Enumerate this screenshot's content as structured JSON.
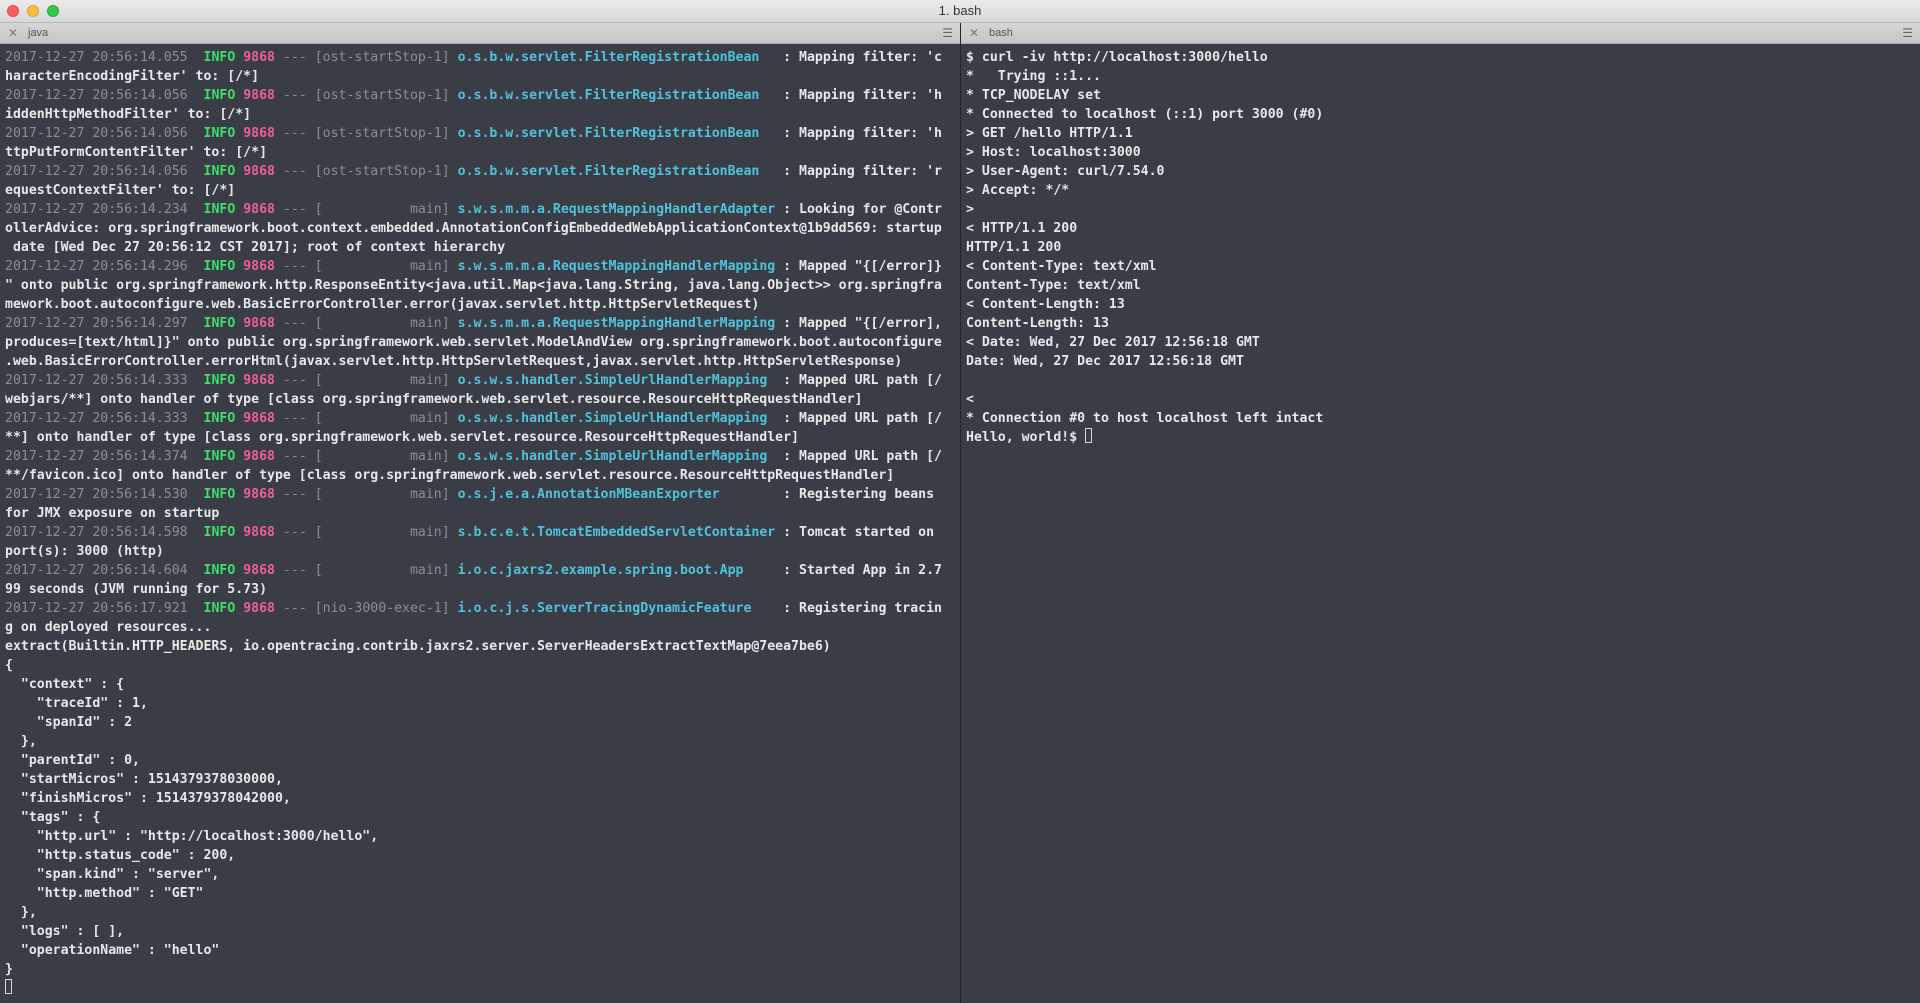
{
  "window": {
    "title": "1. bash"
  },
  "left_pane": {
    "tab_label": "java",
    "log_lines": [
      {
        "ts": "2017-12-27 20:56:14.055",
        "level": "INFO",
        "pid": "9868",
        "sep": " --- ",
        "thread": "[ost-startStop-1]",
        "logger": "o.s.b.w.servlet.FilterRegistrationBean  ",
        "msg": " : Mapping filter: 'c",
        "cont": [
          "haracterEncodingFilter' to: [/*]"
        ]
      },
      {
        "ts": "2017-12-27 20:56:14.056",
        "level": "INFO",
        "pid": "9868",
        "sep": " --- ",
        "thread": "[ost-startStop-1]",
        "logger": "o.s.b.w.servlet.FilterRegistrationBean  ",
        "msg": " : Mapping filter: 'h",
        "cont": [
          "iddenHttpMethodFilter' to: [/*]"
        ]
      },
      {
        "ts": "2017-12-27 20:56:14.056",
        "level": "INFO",
        "pid": "9868",
        "sep": " --- ",
        "thread": "[ost-startStop-1]",
        "logger": "o.s.b.w.servlet.FilterRegistrationBean  ",
        "msg": " : Mapping filter: 'h",
        "cont": [
          "ttpPutFormContentFilter' to: [/*]"
        ]
      },
      {
        "ts": "2017-12-27 20:56:14.056",
        "level": "INFO",
        "pid": "9868",
        "sep": " --- ",
        "thread": "[ost-startStop-1]",
        "logger": "o.s.b.w.servlet.FilterRegistrationBean  ",
        "msg": " : Mapping filter: 'r",
        "cont": [
          "equestContextFilter' to: [/*]"
        ]
      },
      {
        "ts": "2017-12-27 20:56:14.234",
        "level": "INFO",
        "pid": "9868",
        "sep": " --- ",
        "thread": "[           main]",
        "logger": "s.w.s.m.m.a.RequestMappingHandlerAdapter",
        "msg": " : Looking for @Contr",
        "cont": [
          "ollerAdvice: org.springframework.boot.context.embedded.AnnotationConfigEmbeddedWebApplicationContext@1b9dd569: startup",
          " date [Wed Dec 27 20:56:12 CST 2017]; root of context hierarchy"
        ]
      },
      {
        "ts": "2017-12-27 20:56:14.296",
        "level": "INFO",
        "pid": "9868",
        "sep": " --- ",
        "thread": "[           main]",
        "logger": "s.w.s.m.m.a.RequestMappingHandlerMapping",
        "msg": " : Mapped \"{[/error]}",
        "cont": [
          "\" onto public org.springframework.http.ResponseEntity<java.util.Map<java.lang.String, java.lang.Object>> org.springfra",
          "mework.boot.autoconfigure.web.BasicErrorController.error(javax.servlet.http.HttpServletRequest)"
        ]
      },
      {
        "ts": "2017-12-27 20:56:14.297",
        "level": "INFO",
        "pid": "9868",
        "sep": " --- ",
        "thread": "[           main]",
        "logger": "s.w.s.m.m.a.RequestMappingHandlerMapping",
        "msg": " : Mapped \"{[/error],",
        "cont": [
          "produces=[text/html]}\" onto public org.springframework.web.servlet.ModelAndView org.springframework.boot.autoconfigure",
          ".web.BasicErrorController.errorHtml(javax.servlet.http.HttpServletRequest,javax.servlet.http.HttpServletResponse)"
        ]
      },
      {
        "ts": "2017-12-27 20:56:14.333",
        "level": "INFO",
        "pid": "9868",
        "sep": " --- ",
        "thread": "[           main]",
        "logger": "o.s.w.s.handler.SimpleUrlHandlerMapping ",
        "msg": " : Mapped URL path [/",
        "cont": [
          "webjars/**] onto handler of type [class org.springframework.web.servlet.resource.ResourceHttpRequestHandler]"
        ]
      },
      {
        "ts": "2017-12-27 20:56:14.333",
        "level": "INFO",
        "pid": "9868",
        "sep": " --- ",
        "thread": "[           main]",
        "logger": "o.s.w.s.handler.SimpleUrlHandlerMapping ",
        "msg": " : Mapped URL path [/",
        "cont": [
          "**] onto handler of type [class org.springframework.web.servlet.resource.ResourceHttpRequestHandler]"
        ]
      },
      {
        "ts": "2017-12-27 20:56:14.374",
        "level": "INFO",
        "pid": "9868",
        "sep": " --- ",
        "thread": "[           main]",
        "logger": "o.s.w.s.handler.SimpleUrlHandlerMapping ",
        "msg": " : Mapped URL path [/",
        "cont": [
          "**/favicon.ico] onto handler of type [class org.springframework.web.servlet.resource.ResourceHttpRequestHandler]"
        ]
      },
      {
        "ts": "2017-12-27 20:56:14.530",
        "level": "INFO",
        "pid": "9868",
        "sep": " --- ",
        "thread": "[           main]",
        "logger": "o.s.j.e.a.AnnotationMBeanExporter       ",
        "msg": " : Registering beans",
        "cont": [
          "for JMX exposure on startup"
        ]
      },
      {
        "ts": "2017-12-27 20:56:14.598",
        "level": "INFO",
        "pid": "9868",
        "sep": " --- ",
        "thread": "[           main]",
        "logger": "s.b.c.e.t.TomcatEmbeddedServletContainer",
        "msg": " : Tomcat started on",
        "cont": [
          "port(s): 3000 (http)"
        ]
      },
      {
        "ts": "2017-12-27 20:56:14.604",
        "level": "INFO",
        "pid": "9868",
        "sep": " --- ",
        "thread": "[           main]",
        "logger": "i.o.c.jaxrs2.example.spring.boot.App    ",
        "msg": " : Started App in 2.7",
        "cont": [
          "99 seconds (JVM running for 5.73)"
        ]
      },
      {
        "ts": "2017-12-27 20:56:17.921",
        "level": "INFO",
        "pid": "9868",
        "sep": " --- ",
        "thread": "[nio-3000-exec-1]",
        "logger": "i.o.c.j.s.ServerTracingDynamicFeature   ",
        "msg": " : Registering tracin",
        "cont": [
          "g on deployed resources..."
        ]
      }
    ],
    "plain_lines": [
      "extract(Builtin.HTTP_HEADERS, io.opentracing.contrib.jaxrs2.server.ServerHeadersExtractTextMap@7eea7be6)",
      "{",
      "  \"context\" : {",
      "    \"traceId\" : 1,",
      "    \"spanId\" : 2",
      "  },",
      "  \"parentId\" : 0,",
      "  \"startMicros\" : 1514379378030000,",
      "  \"finishMicros\" : 1514379378042000,",
      "  \"tags\" : {",
      "    \"http.url\" : \"http://localhost:3000/hello\",",
      "    \"http.status_code\" : 200,",
      "    \"span.kind\" : \"server\",",
      "    \"http.method\" : \"GET\"",
      "  },",
      "  \"logs\" : [ ],",
      "  \"operationName\" : \"hello\"",
      "}"
    ]
  },
  "right_pane": {
    "tab_label": "bash",
    "lines": [
      "$ curl -iv http://localhost:3000/hello",
      "*   Trying ::1...",
      "* TCP_NODELAY set",
      "* Connected to localhost (::1) port 3000 (#0)",
      "> GET /hello HTTP/1.1",
      "> Host: localhost:3000",
      "> User-Agent: curl/7.54.0",
      "> Accept: */*",
      ">",
      "< HTTP/1.1 200",
      "HTTP/1.1 200",
      "< Content-Type: text/xml",
      "Content-Type: text/xml",
      "< Content-Length: 13",
      "Content-Length: 13",
      "< Date: Wed, 27 Dec 2017 12:56:18 GMT",
      "Date: Wed, 27 Dec 2017 12:56:18 GMT",
      "",
      "<",
      "* Connection #0 to host localhost left intact"
    ],
    "prompt_line": "Hello, world!$ "
  }
}
